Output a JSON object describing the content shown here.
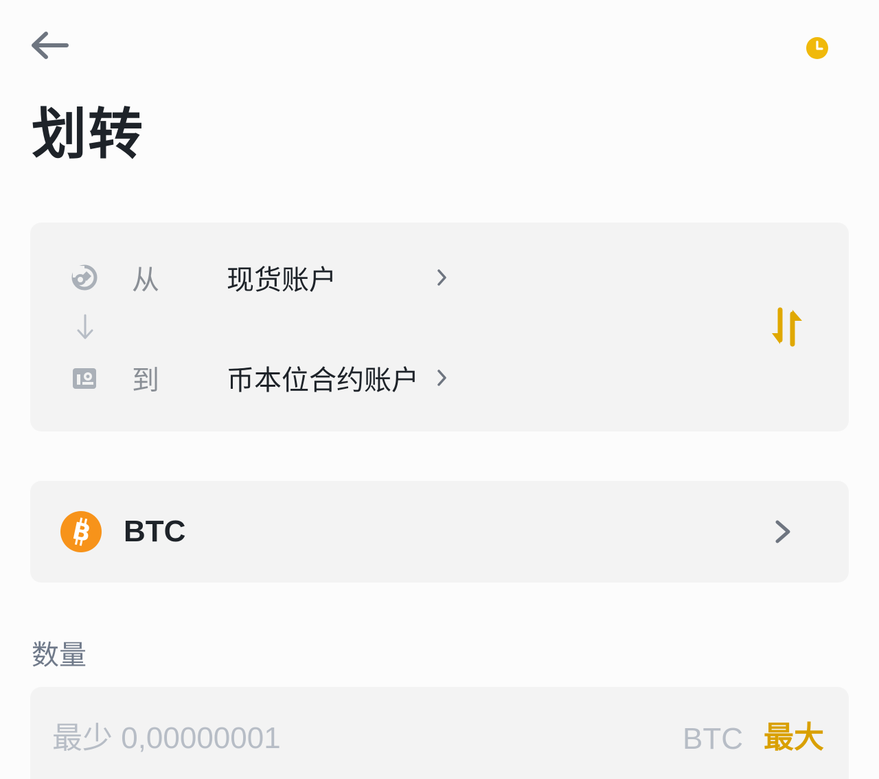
{
  "header": {
    "back_icon": "arrow-left-icon",
    "history_icon": "clock-icon",
    "title": "划转"
  },
  "transfer": {
    "from": {
      "label": "从",
      "account": "现货账户",
      "icon": "spot-wallet-icon"
    },
    "to": {
      "label": "到",
      "account": "币本位合约账户",
      "icon": "futures-wallet-icon"
    },
    "swap_icon": "swap-arrows-icon"
  },
  "coin": {
    "symbol": "BTC",
    "icon": "bitcoin-icon"
  },
  "amount": {
    "label": "数量",
    "placeholder": "最少 0,00000001",
    "unit": "BTC",
    "max_label": "最大"
  },
  "colors": {
    "accent": "#F0B90B",
    "max_text": "#D9A000",
    "bitcoin": "#F7931A",
    "card_bg": "#F3F3F3"
  }
}
